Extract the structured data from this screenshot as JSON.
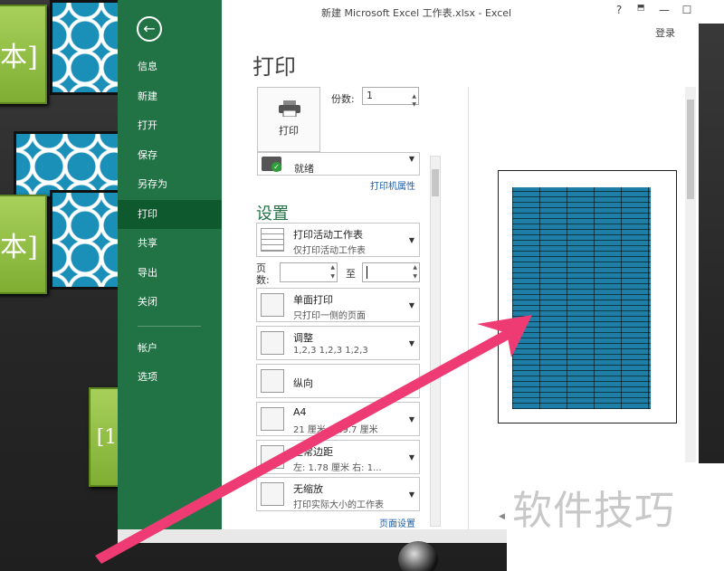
{
  "window": {
    "title": "新建 Microsoft Excel 工作表.xlsx - Excel",
    "help": "?",
    "minimize": "—",
    "maximize": "☐",
    "close": "✕",
    "login": "登录"
  },
  "nav": {
    "back_icon": "←",
    "items": [
      {
        "label": "信息"
      },
      {
        "label": "新建"
      },
      {
        "label": "打开"
      },
      {
        "label": "保存"
      },
      {
        "label": "另存为"
      },
      {
        "label": "打印"
      },
      {
        "label": "共享"
      },
      {
        "label": "导出"
      },
      {
        "label": "关闭"
      },
      {
        "label": "帐户"
      },
      {
        "label": "选项"
      }
    ],
    "active": "打印"
  },
  "print": {
    "title": "打印",
    "button_label": "打印",
    "copies_label": "份数:",
    "copies_value": "1",
    "printer_status": "就绪",
    "printer_properties": "打印机属性",
    "settings_title": "设置",
    "what": {
      "main": "打印活动工作表",
      "sub": "仅打印活动工作表"
    },
    "pages_label": "页数:",
    "pages_from": "",
    "to_label": "至",
    "pages_to": "",
    "sides": {
      "main": "单面打印",
      "sub": "只打印一侧的页面"
    },
    "collate": {
      "main": "调整",
      "sub": "1,2,3    1,2,3    1,2,3"
    },
    "orientation": {
      "main": "纵向"
    },
    "paper": {
      "main": "A4",
      "sub": "21 厘米 x 29.7 厘米"
    },
    "margins": {
      "main": "正常边距",
      "sub": "左: 1.78 厘米   右: 1..."
    },
    "scaling": {
      "main": "无缩放",
      "sub": "打印实际大小的工作表"
    },
    "page_setup": "页面设置"
  },
  "desktop": {
    "tile_text": "本]",
    "tile_text_small": "[1",
    "watermark": "软件技巧"
  },
  "colors": {
    "excel_green": "#217346",
    "active_nav": "#0e5a2e",
    "arrow": "#ee3b74",
    "preview_sheet": "#1f7ea6"
  }
}
